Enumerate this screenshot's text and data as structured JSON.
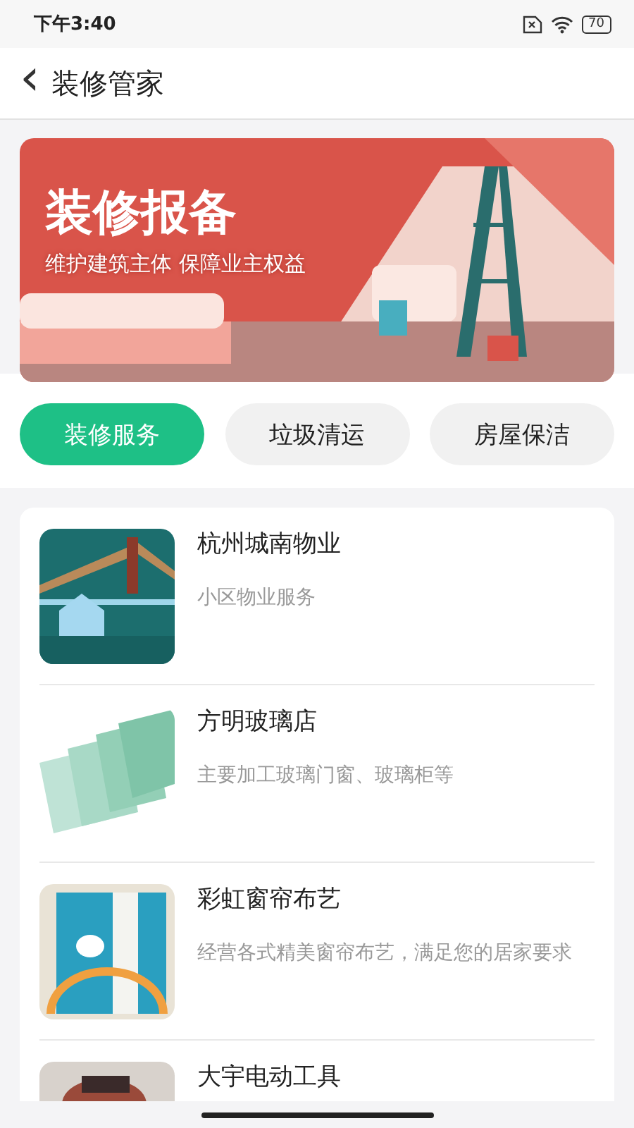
{
  "status_bar": {
    "time": "下午3:40",
    "battery": "70"
  },
  "header": {
    "back": "‹",
    "title": "装修管家"
  },
  "banner": {
    "kind": "picture",
    "title": "装修报备",
    "subtitle": "维护建筑主体 保障业主权益"
  },
  "tabs": [
    {
      "label": "装修服务",
      "selected": true
    },
    {
      "label": "垃圾清运",
      "selected": false
    },
    {
      "label": "房屋保洁",
      "selected": false
    }
  ],
  "shops": [
    {
      "name": "杭州城南物业",
      "description": "小区物业服务",
      "kind": "house"
    },
    {
      "name": "方明玻璃店",
      "description": "主要加工玻璃门窗、玻璃柜等",
      "kind": "glass"
    },
    {
      "name": "彩虹窗帘布艺",
      "description": "经营各式精美窗帘布艺，满足您的居家要求",
      "kind": "curtain"
    },
    {
      "name": "大宇电动工具",
      "kind": "tool"
    }
  ]
}
